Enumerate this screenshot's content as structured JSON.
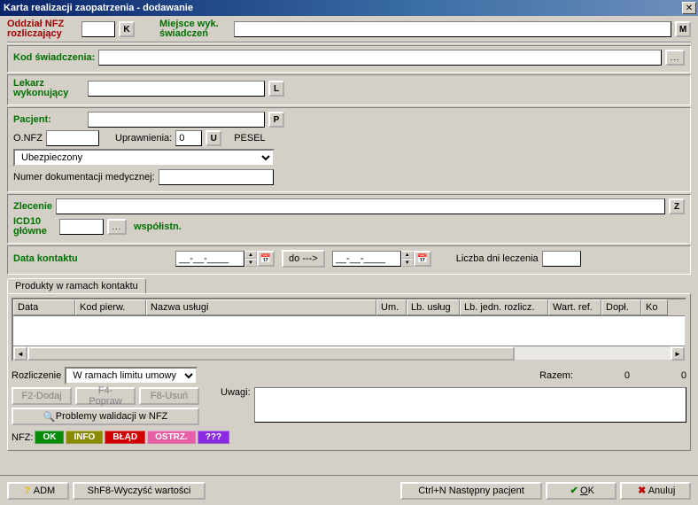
{
  "window": {
    "title": "Karta realizacji zaopatrzenia - dodawanie"
  },
  "top": {
    "oddzial_label": "Oddział NFZ rozliczający",
    "oddzial_value": "",
    "oddzial_btn": "K",
    "miejsce_label": "Miejsce wyk. świadczeń",
    "miejsce_value": "",
    "miejsce_btn": "M"
  },
  "kod": {
    "label": "Kod świadczenia:",
    "value": "",
    "btn": "..."
  },
  "lekarz": {
    "label": "Lekarz wykonujący",
    "value": "",
    "btn": "L"
  },
  "pacjent": {
    "label": "Pacjent:",
    "value": "",
    "btn": "P",
    "onfz_label": "O.NFZ",
    "onfz_value": "",
    "upr_label": "Uprawnienia:",
    "upr_value": "0",
    "upr_btn": "U",
    "pesel_label": "PESEL",
    "select_value": "Ubezpieczony",
    "doc_label": "Numer dokumentacji medycznej:",
    "doc_value": ""
  },
  "zlecenie": {
    "label": "Zlecenie",
    "value": "",
    "btn": "Z"
  },
  "icd10": {
    "label": "ICD10 główne",
    "value": "",
    "btn": "...",
    "wsp_label": "współistn."
  },
  "kontakt": {
    "label": "Data kontaktu",
    "date_from": "__-__-____",
    "do_btn": "do --->",
    "date_to": "__-__-____",
    "dni_label": "Liczba dni leczenia",
    "dni_value": ""
  },
  "products_tab": "Produkty w ramach kontaktu",
  "grid_cols": [
    "Data",
    "Kod pierw.",
    "Nazwa usługi",
    "Um.",
    "Lb. usług",
    "Lb. jedn. rozlicz.",
    "Wart. ref.",
    "Dopł.",
    "Ko"
  ],
  "rozlicz": {
    "label": "Rozliczenie",
    "select_value": "W ramach limitu umowy",
    "razem_label": "Razem:",
    "razem_v1": "0",
    "razem_v2": "0"
  },
  "actions": {
    "f2": "F2-Dodaj",
    "f4": "F4-Popraw",
    "f8": "F8-Usuń",
    "walidacja": "Problemy walidacji w NFZ",
    "uwagi_label": "Uwagi:",
    "uwagi_value": ""
  },
  "nfz": {
    "prefix": "NFZ:",
    "chips": [
      {
        "text": "OK",
        "color": "#0a8a0a"
      },
      {
        "text": "INFO",
        "color": "#8b8b00"
      },
      {
        "text": "BŁĄD",
        "color": "#d00000"
      },
      {
        "text": "OSTRZ.",
        "color": "#e85fa7"
      },
      {
        "text": "???",
        "color": "#8a2be2"
      }
    ]
  },
  "footer": {
    "adm": "ADM",
    "clear": "ShF8-Wyczyść wartości",
    "next": "Ctrl+N Następny pacjent",
    "ok": "OK",
    "cancel": "Anuluj"
  }
}
